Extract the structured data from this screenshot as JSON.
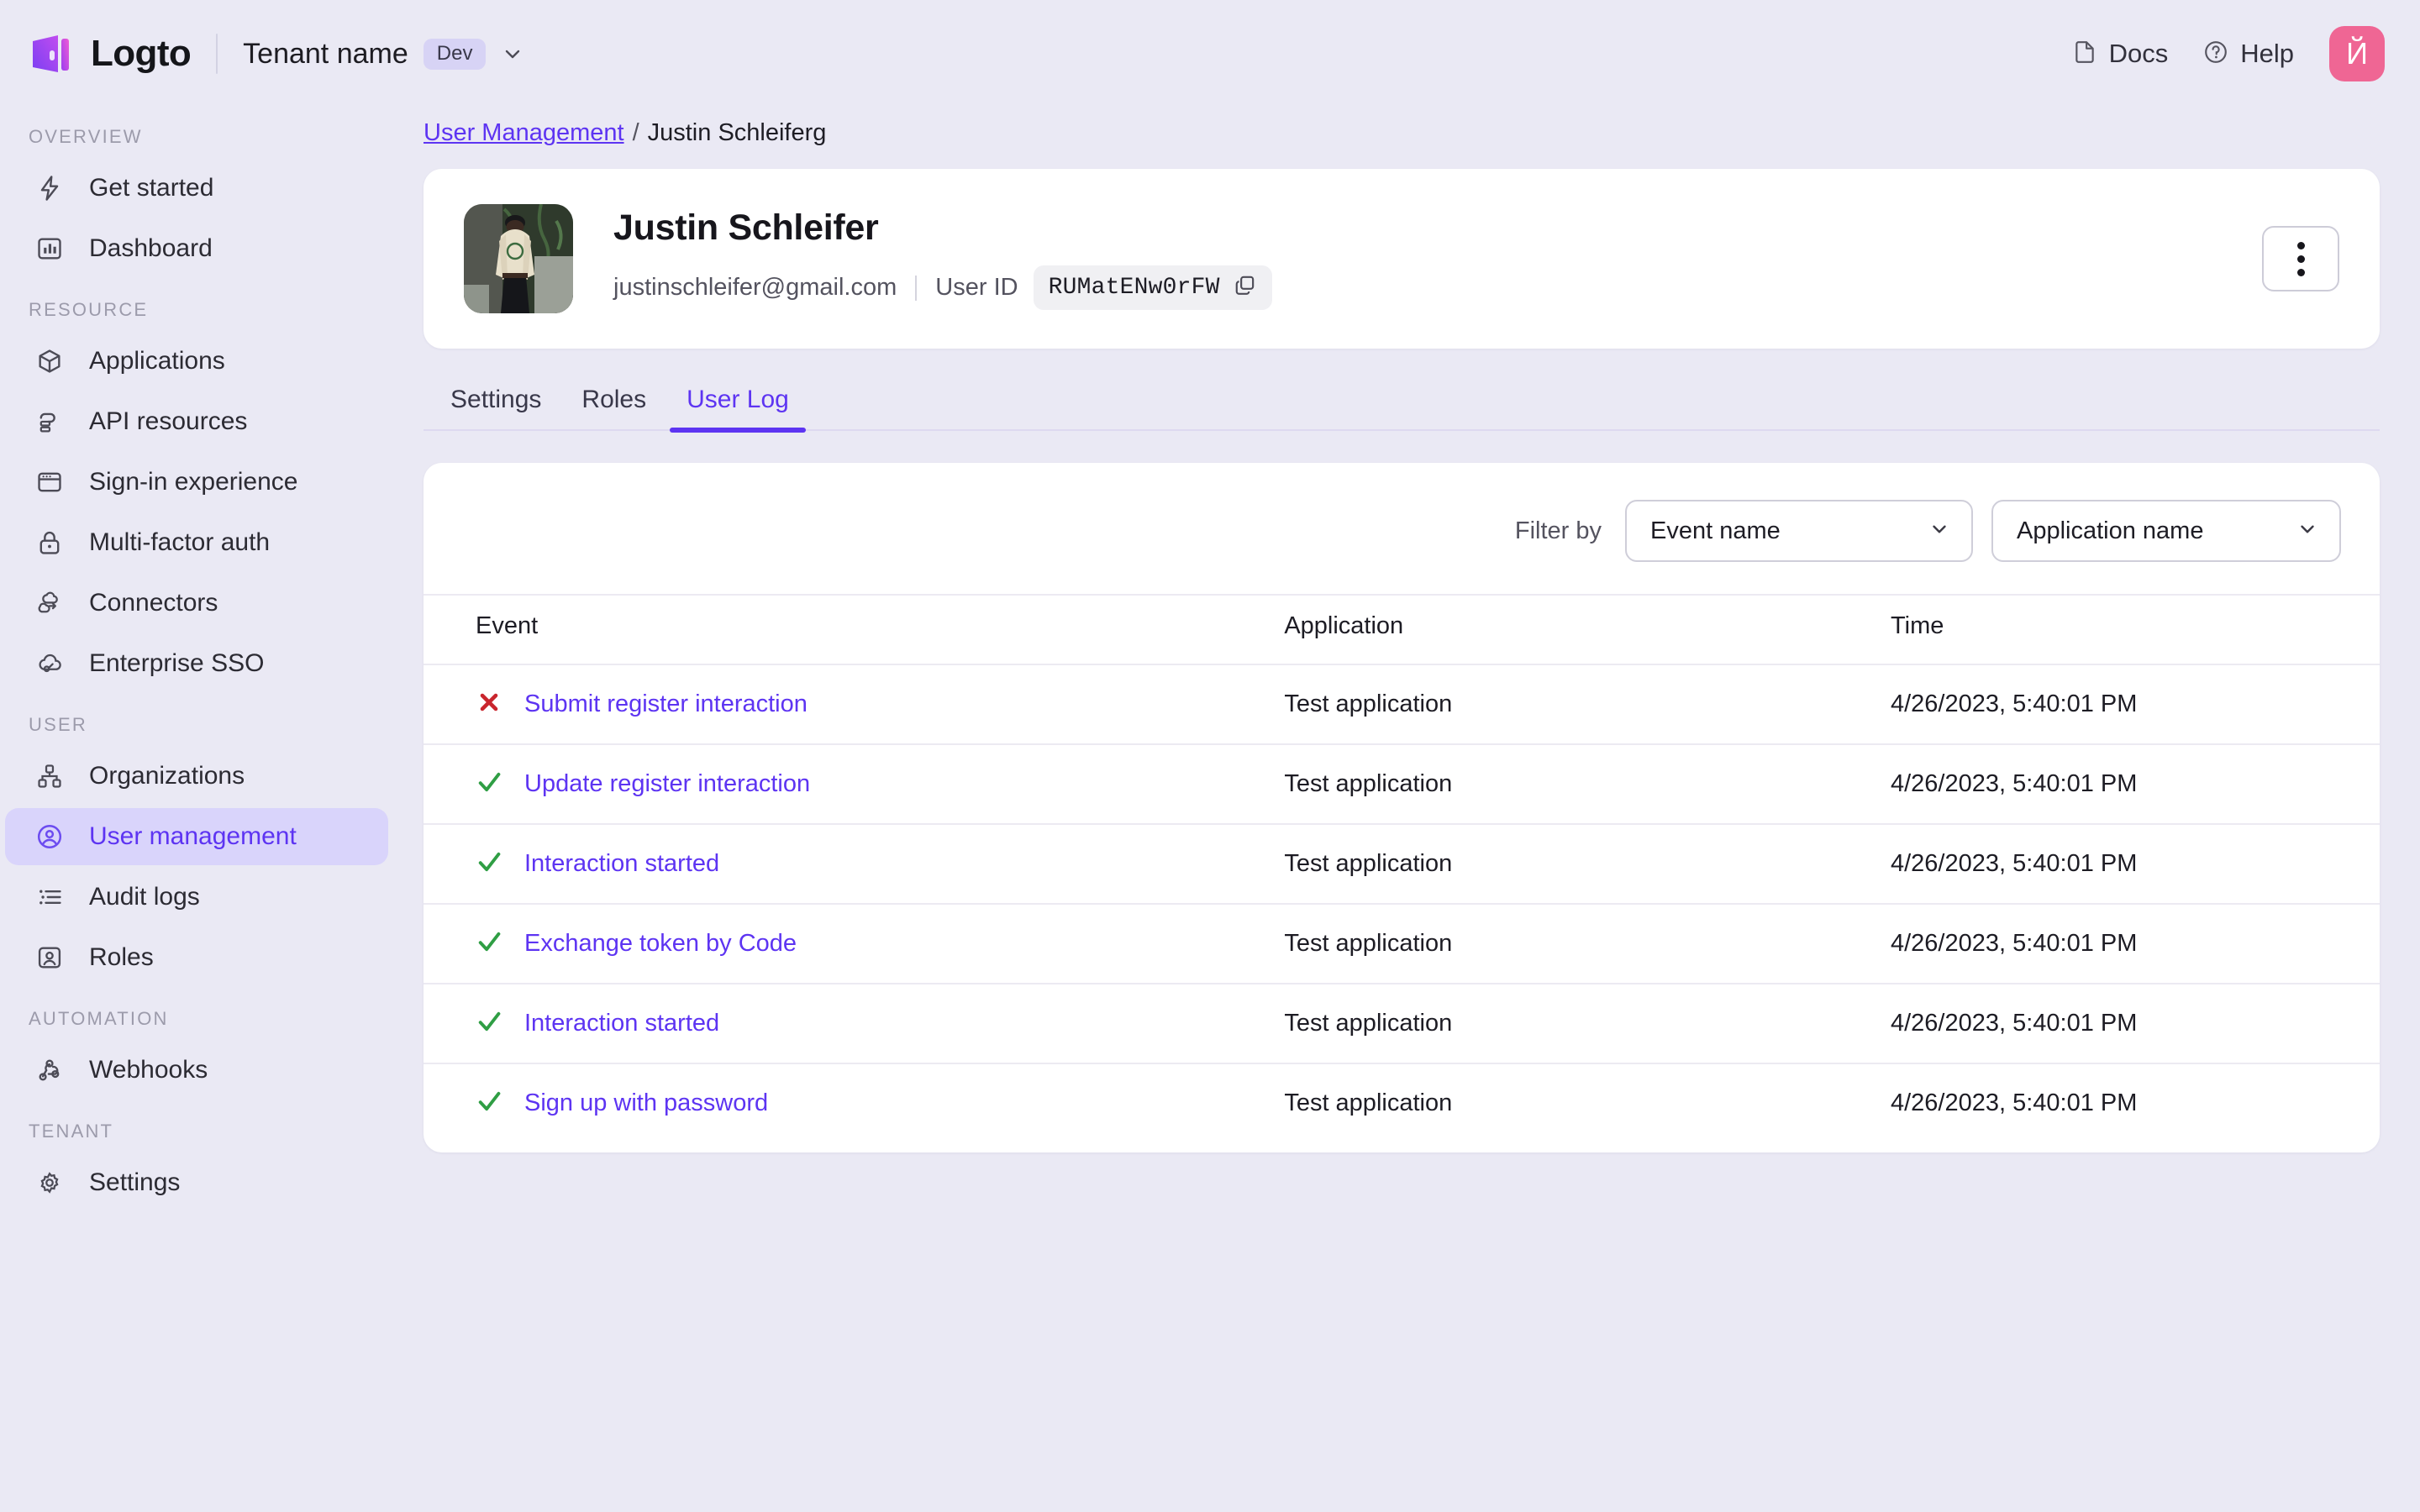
{
  "topbar": {
    "brand": "Logto",
    "tenant_name": "Tenant name",
    "tenant_badge": "Dev",
    "docs_label": "Docs",
    "help_label": "Help",
    "avatar_initial": "Й",
    "avatar_color": "#ef6694"
  },
  "sidebar": {
    "sections": [
      {
        "label": "OVERVIEW",
        "items": [
          {
            "label": "Get started",
            "icon": "bolt-icon",
            "active": false
          },
          {
            "label": "Dashboard",
            "icon": "chart-bar-icon",
            "active": false
          }
        ]
      },
      {
        "label": "RESOURCE",
        "items": [
          {
            "label": "Applications",
            "icon": "cube-icon",
            "active": false
          },
          {
            "label": "API resources",
            "icon": "api-resources-icon",
            "active": false
          },
          {
            "label": "Sign-in experience",
            "icon": "browser-window-icon",
            "active": false
          },
          {
            "label": "Multi-factor auth",
            "icon": "lock-icon",
            "active": false
          },
          {
            "label": "Connectors",
            "icon": "connectors-icon",
            "active": false
          },
          {
            "label": "Enterprise SSO",
            "icon": "cloud-key-icon",
            "active": false
          }
        ]
      },
      {
        "label": "USER",
        "items": [
          {
            "label": "Organizations",
            "icon": "org-tree-icon",
            "active": false
          },
          {
            "label": "User management",
            "icon": "user-circle-icon",
            "active": true
          },
          {
            "label": "Audit logs",
            "icon": "list-icon",
            "active": false
          },
          {
            "label": "Roles",
            "icon": "user-badge-icon",
            "active": false
          }
        ]
      },
      {
        "label": "AUTOMATION",
        "items": [
          {
            "label": "Webhooks",
            "icon": "webhook-icon",
            "active": false
          }
        ]
      },
      {
        "label": "TENANT",
        "items": [
          {
            "label": "Settings",
            "icon": "gear-icon",
            "active": false
          }
        ]
      }
    ],
    "active_color": "#5d34f2",
    "active_bg": "#d9d4fb"
  },
  "breadcrumb": {
    "parent": "User Management",
    "separator": "/",
    "current": "Justin Schleiferg"
  },
  "user_card": {
    "name": "Justin Schleifer",
    "email": "justinschleifer@gmail.com",
    "user_id_label": "User ID",
    "user_id_value": "RUMatENw0rFW",
    "copy_icon": "copy-icon",
    "more_menu_icon": "dots-vertical-icon"
  },
  "tabs": [
    {
      "label": "Settings",
      "active": false
    },
    {
      "label": "Roles",
      "active": false
    },
    {
      "label": "User Log",
      "active": true
    }
  ],
  "filter": {
    "label": "Filter by",
    "event_select": "Event name",
    "application_select": "Application name"
  },
  "table": {
    "headers": [
      "Event",
      "Application",
      "Time"
    ],
    "rows": [
      {
        "status": "error",
        "event": "Submit register interaction",
        "application": "Test application",
        "time": "4/26/2023, 5:40:01 PM"
      },
      {
        "status": "success",
        "event": "Update register interaction",
        "application": "Test application",
        "time": "4/26/2023, 5:40:01 PM"
      },
      {
        "status": "success",
        "event": "Interaction started",
        "application": "Test application",
        "time": "4/26/2023, 5:40:01 PM"
      },
      {
        "status": "success",
        "event": "Exchange token by Code",
        "application": "Test application",
        "time": "4/26/2023, 5:40:01 PM"
      },
      {
        "status": "success",
        "event": "Interaction started",
        "application": "Test application",
        "time": "4/26/2023, 5:40:01 PM"
      },
      {
        "status": "success",
        "event": "Sign up with password",
        "application": "Test application",
        "time": "4/26/2023, 5:40:01 PM"
      }
    ],
    "status_colors": {
      "success": "#2f9e44",
      "error": "#c9252d"
    }
  },
  "theme": {
    "page_bg": "#eae9f4",
    "card_bg": "#ffffff",
    "accent": "#5d34f2",
    "text": "#1d1c24",
    "muted": "#54535f"
  }
}
